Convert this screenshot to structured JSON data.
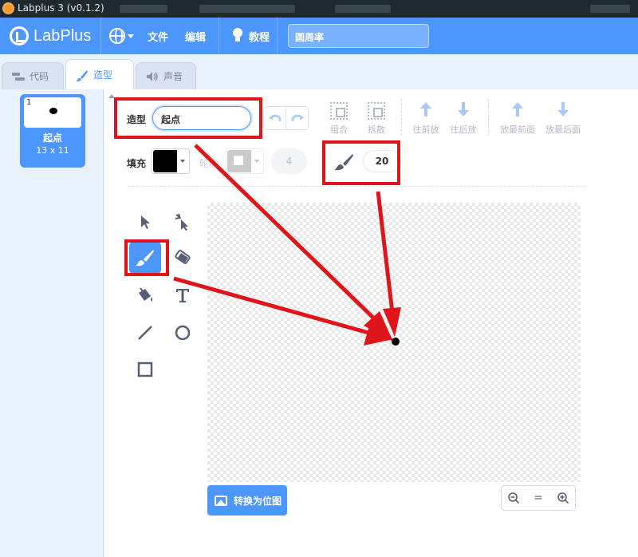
{
  "window": {
    "title": "Labplus 3 (v0.1.2)"
  },
  "menubar": {
    "logo_text": "LabPlus",
    "file": "文件",
    "edit": "编辑",
    "tutorial": "教程",
    "project_title": "圆周率"
  },
  "tabs": [
    {
      "label": "代码",
      "icon": "code-icon"
    },
    {
      "label": "造型",
      "icon": "brush-icon"
    },
    {
      "label": "声音",
      "icon": "speaker-icon"
    }
  ],
  "costumes": [
    {
      "number": "1",
      "name": "起点",
      "size": "13 x 11"
    }
  ],
  "editor": {
    "costume_label": "造型",
    "costume_name": "起点",
    "group": "组合",
    "ungroup": "拆散",
    "forward": "往前放",
    "backward": "往后放",
    "front": "放最前面",
    "back": "放最后面",
    "fill_label": "填充",
    "fill_color": "#000000",
    "outline_label": "轮廓",
    "outline_width": "4",
    "brush_size": "20",
    "convert_bitmap": "转换为位图",
    "zoom_reset": "="
  },
  "colors": {
    "accent": "#4c97ff",
    "annotation": "#e0151c"
  }
}
